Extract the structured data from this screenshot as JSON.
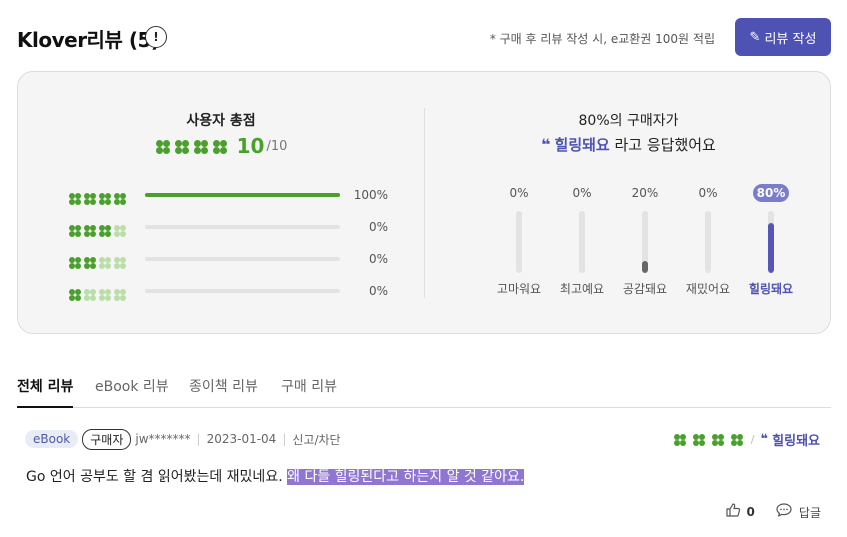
{
  "header": {
    "title": "Klover리뷰 (5)",
    "info_icon": "!",
    "notice": "* 구매 후 리뷰 작성 시, e교환권 100원 적립",
    "write_button": "리뷰 작성",
    "write_icon": "pencil-icon"
  },
  "summary": {
    "score_title": "사용자 총점",
    "score": "10",
    "score_max": "/10",
    "distribution": [
      {
        "clovers_on": 4,
        "percent_label": "100%",
        "percent": 100
      },
      {
        "clovers_on": 3,
        "percent_label": "0%",
        "percent": 0
      },
      {
        "clovers_on": 2,
        "percent_label": "0%",
        "percent": 0
      },
      {
        "clovers_on": 1,
        "percent_label": "0%",
        "percent": 0
      }
    ],
    "buyer_line1": "80%의 구매자가",
    "buyer_quote_mark": "❝",
    "buyer_highlight": "힐링돼요",
    "buyer_suffix": " 라고 응답했어요",
    "emotions": [
      {
        "label": "고마워요",
        "percent_label": "0%",
        "percent": 0,
        "active": false
      },
      {
        "label": "최고예요",
        "percent_label": "0%",
        "percent": 0,
        "active": false
      },
      {
        "label": "공감돼요",
        "percent_label": "20%",
        "percent": 20,
        "active": false
      },
      {
        "label": "재밌어요",
        "percent_label": "0%",
        "percent": 0,
        "active": false
      },
      {
        "label": "힐링돼요",
        "percent_label": "80%",
        "percent": 80,
        "active": true
      }
    ]
  },
  "tabs": [
    {
      "label": "전체 리뷰",
      "active": true
    },
    {
      "label": "eBook 리뷰",
      "active": false
    },
    {
      "label": "종이책 리뷰",
      "active": false
    },
    {
      "label": "구매 리뷰",
      "active": false
    }
  ],
  "review": {
    "format_badge": "eBook",
    "buyer_badge": "구매자",
    "user": "jw*******",
    "date": "2023-01-04",
    "report": "신고/차단",
    "slash": "/",
    "quote_mark": "❝",
    "emotion": "힐링돼요",
    "text_plain": "Go 언어 공부도 할 겸 읽어봤는데 재밌네요. ",
    "text_selected": "왜 다들 힐링된다고 하는지 알 것 같아요.",
    "like_count": "0",
    "reply_label": "답글",
    "like_icon": "thumbs-up-icon",
    "reply_icon": "comment-icon"
  },
  "colors": {
    "accent": "#4e52b3",
    "clover_on": "#4aa02c",
    "clover_off": "#b9dea9",
    "selection": "#8f76d1"
  }
}
